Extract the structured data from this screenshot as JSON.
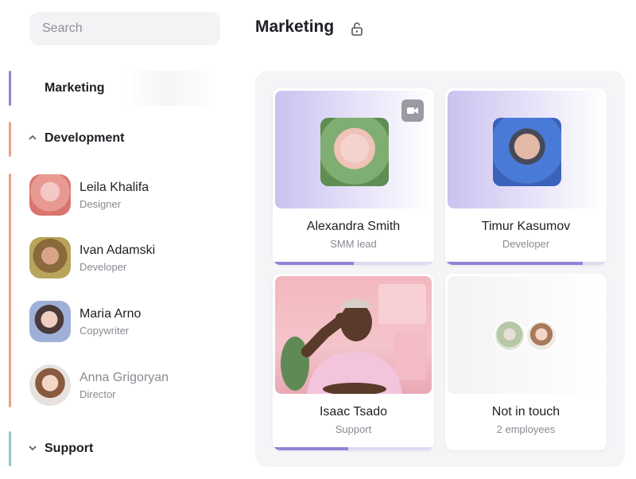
{
  "sidebar": {
    "search": {
      "placeholder": "Search",
      "value": ""
    },
    "groups": [
      {
        "label": "Marketing",
        "accent": "#8f83d8",
        "active": true
      },
      {
        "label": "Development",
        "accent": "#e6a388",
        "expanded": true
      },
      {
        "label": "Support",
        "accent": "#8fc7cf",
        "expanded": false
      }
    ],
    "members": [
      {
        "name": "Leila Khalifa",
        "role": "Designer"
      },
      {
        "name": "Ivan Adamski",
        "role": "Developer"
      },
      {
        "name": "Maria Arno",
        "role": "Copywriter"
      },
      {
        "name": "Anna Grigoryan",
        "role": "Director"
      }
    ]
  },
  "header": {
    "title": "Marketing",
    "lock_icon": "unlock-icon"
  },
  "cards": [
    {
      "name": "Alexandra Smith",
      "role": "SMM lead",
      "progress": 0.5,
      "camera": true
    },
    {
      "name": "Timur Kasumov",
      "role": "Developer",
      "progress": 0.85
    },
    {
      "name": "Isaac Tsado",
      "role": "Support",
      "progress": 0.47
    },
    {
      "name": "Not in touch",
      "role": "2 employees",
      "progress": 0
    }
  ],
  "colors": {
    "accent": "#8f83d8",
    "panel_bg": "#f5f5f8"
  }
}
